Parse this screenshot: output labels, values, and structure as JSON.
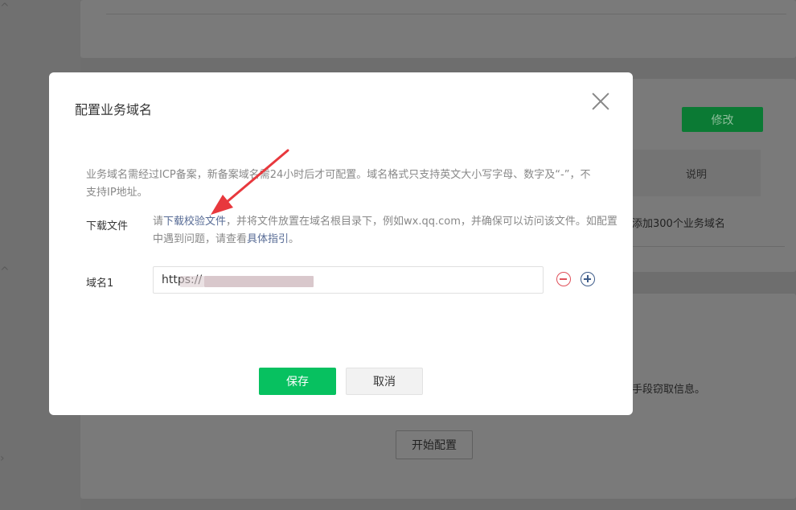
{
  "background": {
    "edit_button": "修改",
    "column_header": "说明",
    "row_text": "添加300个业务域名",
    "warning_text": "手段窃取信息。",
    "start_button": "开始配置"
  },
  "modal": {
    "title": "配置业务域名",
    "tips": "业务域名需经过ICP备案，新备案域名需24小时后才可配置。域名格式只支持英文大小写字母、数字及“-”，不支持IP地址。",
    "download": {
      "label": "下载文件",
      "prefix": "请",
      "link": "下载校验文件",
      "middle": "，并将文件放置在域名根目录下，例如wx.qq.com，并确保可以访问该文件。如配置中遇到问题，请查看",
      "guide_link": "具体指引",
      "suffix": "。"
    },
    "domain": {
      "label": "域名1",
      "value": "https://"
    },
    "save_button": "保存",
    "cancel_button": "取消"
  },
  "colors": {
    "primary_green": "#07c160",
    "link_blue": "#576b95",
    "annotation_red": "#e8383d"
  }
}
